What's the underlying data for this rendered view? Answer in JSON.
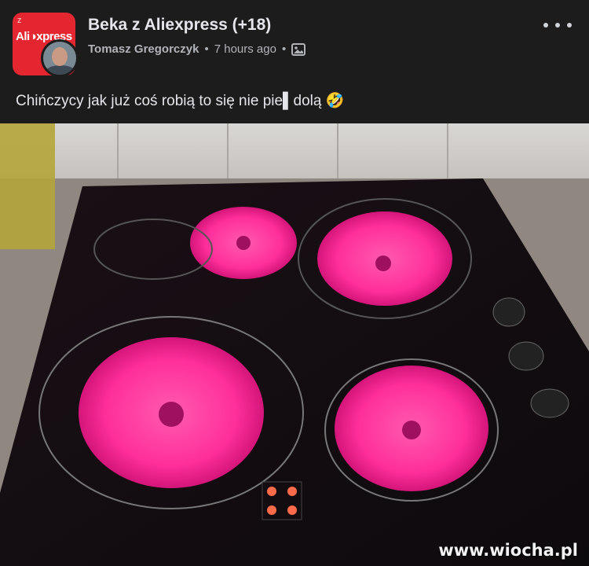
{
  "post": {
    "group_name": "Beka z Aliexpress (+18)",
    "author": "Tomasz Gregorczyk",
    "time": "7 hours ago",
    "separator": "•",
    "audience_icon": "photo-album-icon",
    "text": "Chińczycy jak już coś robią to się nie pie▌dolą 🤣",
    "more_icon": "more-options-icon"
  },
  "group_avatar": {
    "logo_text": "Ali◑xpress",
    "top_text": "z",
    "brand_color": "#e3262f"
  },
  "image": {
    "description_icon": "glowing-induction-cooktop-photo",
    "burner_color": "#ff2f9a"
  },
  "watermark": "www.wiocha.pl"
}
